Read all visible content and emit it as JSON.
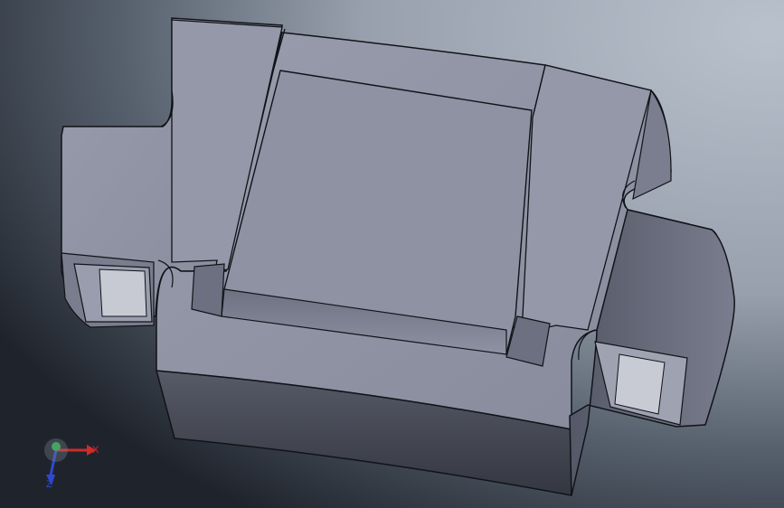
{
  "triad": {
    "x_label": "X",
    "z_label": "Z"
  },
  "colors": {
    "background_dark": "#262b35",
    "background_light": "#aeb7c4",
    "face_top": "#8e91a2",
    "face_front": "#474a56",
    "face_side": "#676a7a",
    "edge": "#111318",
    "axis_x": "#d22a2a",
    "axis_y": "#2bb34b",
    "axis_z": "#2f48d1"
  },
  "icons": {
    "triad": "xyz-triad-icon",
    "model": "3d-part-model"
  }
}
